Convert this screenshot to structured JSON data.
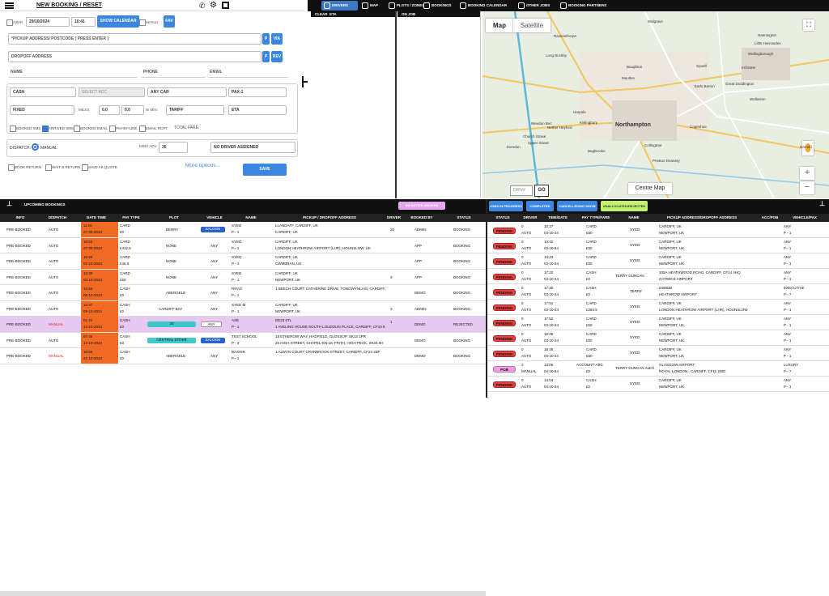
{
  "header": {
    "title": "NEW BOOKING / RESET"
  },
  "tabs": [
    {
      "label": "DRIVERS",
      "active": true
    },
    {
      "label": "MAP"
    },
    {
      "label": "PLOTS / ZONES"
    },
    {
      "label": "BOOKINGS"
    },
    {
      "label": "BOOKING CALENDAR"
    },
    {
      "label": "OTHER JOBS"
    },
    {
      "label": "BOOKING PARTNERS"
    }
  ],
  "form": {
    "asap": "ASAP",
    "date": "29/10/2024",
    "time": "10:41",
    "show_calendar": "SHOW CALENDAR",
    "repeat": "REPEAT",
    "fav": "FAV",
    "pickup_placeholder": "*PICKUP ADDRESS/ POSTCODE [ PRESS ENTER ]",
    "p_btn": "P",
    "via_btn": "VIA",
    "dropoff_placeholder": "DROPOFF ADDRESS",
    "rev_btn": "REV",
    "name_ph": "NAME",
    "phone_ph": "PHONE",
    "email_ph": "EMAIL",
    "pay": "CASH",
    "acc": "SELECT ACC",
    "car": "ANY CAR",
    "pax": "PAX-1",
    "fixed": "FIXED",
    "miles_label": "MILES",
    "miles_val": "0.0",
    "miles_val2": "0.0",
    "wmin_label": "W MIN",
    "tariff": "TARIFF",
    "eta": "ETA",
    "booked_sms": "BOOKED SMS",
    "arrived_sms": "ARRIVED SMS",
    "booked_email": "BOOKED EMAIL",
    "pay_by_link": "PAY-BY-LINK",
    "email_rcpt": "EMAIL RCPT",
    "total_fare": "TOTAL FARE:",
    "dispatch_label": "DISPATCH:",
    "manual": "MANUAL",
    "mins_adv_label": "MINS ADV",
    "mins_adv": "35",
    "driver_select": "NO DRIVER ASSIGNED",
    "book_return": "BOOK RETURN",
    "wait_return": "WAIT & RETURN",
    "save_quote": "SAVE AS QUOTE",
    "more_options": "More options...",
    "save": "SAVE"
  },
  "drivers_panel": {
    "clear": "CLEAR",
    "eta": "ETA",
    "on_job": "ON JOB"
  },
  "map": {
    "map_tab": "Map",
    "satellite_tab": "Satellite",
    "centre": "Centre Map",
    "driver_ph": "DRIV#",
    "go": "GO",
    "places": [
      "Walgrave",
      "Ravensthorpe",
      "Hannington",
      "Little Harrowden",
      "Wellingborough",
      "Long Buckby",
      "Moulton",
      "Sywell",
      "Irchester",
      "Earls Barton",
      "Great Doddington",
      "Boughton",
      "Wollaston",
      "Harpole",
      "Northampton",
      "Kislingbury",
      "Collingtree",
      "Cogenhoe",
      "Bugbrooke",
      "Preston Deanery",
      "Nether Heyford",
      "Weedon Bec",
      "Church Stowe",
      "Upper Stowe",
      "Everdon",
      "Harrold"
    ]
  },
  "upcoming": {
    "title": "UPCOMING BOOKINGS",
    "badge": "NO ACTIVE DRIVERS",
    "columns": [
      "INFO",
      "DISPATCH",
      "DATE TIME",
      "PAY TYPE",
      "PLOT",
      "VEHICLE",
      "NAME",
      "PICKUP / DROPOFF ADDRESS",
      "DRIVER",
      "BOOKED BY",
      "STATUS"
    ],
    "rows": [
      {
        "info": "PRE-BOOKED",
        "dispatch": "AUTO",
        "time": "11:00",
        "date": "27-09-2024",
        "pay": "CARD",
        "fare": "£0",
        "plot": "BERRY",
        "vehicle": "SALOON",
        "name": "SYED",
        "pax": "P - 1",
        "pickup": "LLANDAFF, CARDIFF, UK",
        "dropoff": "CARDIFF, UK",
        "driver": "20",
        "booked": "ADMIN",
        "status": "BOOKING"
      },
      {
        "info": "PRE-BOOKED",
        "dispatch": "AUTO",
        "time": "15:53",
        "date": "27-09-2024",
        "pay": "CARD",
        "fare": "£412.5",
        "plot": "NONE",
        "vehicle": "ANY",
        "name": "SYED",
        "pax": "P - 1",
        "pickup": "CARDIFF, UK",
        "dropoff": "LONDON HEATHROW AIRPORT (LHR), HOUNSLOW, UK",
        "driver": "",
        "booked": "APP",
        "status": "BOOKING"
      },
      {
        "info": "PRE-BOOKED",
        "dispatch": "AUTO",
        "time": "15:48",
        "date": "02-10-2024",
        "pay": "CARD",
        "fare": "£45.5",
        "plot": "NONE",
        "vehicle": "ANY",
        "name": "SYED",
        "pax": "P - 1",
        "pickup": "CARDIFF, UK",
        "dropoff": "CWMBRAN, UK",
        "driver": "",
        "booked": "APP",
        "status": "BOOKING"
      },
      {
        "info": "PRE-BOOKED",
        "dispatch": "AUTO",
        "time": "10:39",
        "date": "03-10-2024",
        "pay": "CARD",
        "fare": "£50",
        "plot": "NONE",
        "vehicle": "ANY",
        "name": "SYED",
        "pax": "P - 1",
        "pickup": "CARDIFF, UK",
        "dropoff": "NEWPORT, UK",
        "driver": "3",
        "booked": "APP",
        "status": "BOOKING"
      },
      {
        "info": "PRE-BOOKED",
        "dispatch": "AUTO",
        "time": "15:59",
        "date": "08-10-2024",
        "pay": "CASH",
        "fare": "£0",
        "plot": "ABERGELE",
        "vehicle": "ANY",
        "name": "RIFAS",
        "pax": "P - 1",
        "pickup": "1 BEECH COURT CATHERINE DRIVE, TONGWYNLAIS, CARDIFF,",
        "dropoff": "",
        "driver": "",
        "booked": "DEMO",
        "status": "BOOKING"
      },
      {
        "info": "PRE-BOOKED",
        "dispatch": "AUTO",
        "time": "12:37",
        "date": "09-10-2024",
        "pay": "CASH",
        "fare": "£0",
        "plot": "CARDIFF BAY",
        "vehicle": "ANY",
        "name": "SYED M",
        "pax": "P - 1",
        "pickup": "CARDIFF, UK",
        "dropoff": "NEWPORT, UK",
        "driver": "2",
        "booked": "ADMIN",
        "status": "BOOKING"
      },
      {
        "info": "PRE-BOOKED",
        "dispatch": "MANUAL",
        "time": "01:42",
        "date": "13-10-2024",
        "pay": "CASH",
        "fare": "£0",
        "plot": "20",
        "vehicle": "ANY",
        "name": "ASE",
        "pax": "P - 1",
        "pickup": "DE23 6TL",
        "dropoff": "1 AVELING HOUSE SOUTH LOUDOUN PLACE, CARDIFF, CF10 5",
        "driver": "1",
        "booked": "DEMO",
        "status": "REJECTED"
      },
      {
        "info": "PRE-BOOKED",
        "dispatch": "AUTO",
        "time": "07:45",
        "date": "14-10-2024",
        "pay": "CASH",
        "fare": "£0",
        "plot": "CENTRAL STOKE",
        "vehicle": "SALOON",
        "name": "TEST SCHOOL",
        "pax": "P - 4",
        "pickup": "18 ETHEROW WAY, HADFIELD, GLOSSOP, SK13 1PR",
        "dropoff": "25 HIGH STREET, CHAPEL-EN-LE-FRITH, HIGH PEAK, SK23 0H",
        "driver": "",
        "booked": "DEMO",
        "status": "BOOKING"
      },
      {
        "info": "PRE-BOOKED",
        "dispatch": "MANUAL",
        "time": "15:58",
        "date": "21-10-2024",
        "pay": "CASH",
        "fare": "£0",
        "plot": "ABERGELE",
        "vehicle": "ANY",
        "name": "BASHIR",
        "pax": "P - 1",
        "pickup": "1 ALWYN COURT CRANBROOK STREET, CARDIFF, CF24 4BF",
        "dropoff": "",
        "driver": "",
        "booked": "DEMO",
        "status": "BOOKING"
      }
    ]
  },
  "jobs": {
    "tabs": [
      "JOBS IN PROGRESS",
      "COMPLETED",
      "CANCELLED/NO SHOW",
      "UNALLOCATED/REJECTED"
    ],
    "columns": [
      "STATUS",
      "DRIVER",
      "TIME/DATE",
      "PAY TYPE/FARE",
      "NAME",
      "PICKUP ADDRESS/DROPOFF ADDRESS",
      "ACC/POB",
      "VEHICLE/PAX"
    ],
    "rows": [
      {
        "status": "PENDING",
        "d1": "0",
        "d2": "AUTO",
        "t1": "10:37",
        "t2": "03-10-24",
        "p1": "CARD",
        "p2": "£50",
        "name": "SYED",
        "a1": "CARDIFF, UK",
        "a2": "NEWPORT, UK",
        "v1": "ANY",
        "v2": "P - 1"
      },
      {
        "status": "PENDING",
        "d1": "0",
        "d2": "AUTO",
        "t1": "10:42",
        "t2": "03-10-24",
        "p1": "CARD",
        "p2": "£50",
        "name": "SYED",
        "a1": "CARDIFF, UK",
        "a2": "NEWPORT, UK",
        "v1": "ANY",
        "v2": "P - 1"
      },
      {
        "status": "PENDING",
        "d1": "0",
        "d2": "AUTO",
        "t1": "10:43",
        "t2": "03-10-24",
        "p1": "CARD",
        "p2": "£50",
        "name": "SYED",
        "a1": "CARDIFF, UK",
        "a2": "NEWPORT, UK",
        "v1": "ANY",
        "v2": "P - 1"
      },
      {
        "status": "PENDING",
        "d1": "0",
        "d2": "AUTO",
        "t1": "17:20",
        "t2": "03-10-24",
        "p1": "CASH",
        "p2": "£0",
        "name": "TERRY DUNCAN",
        "a1": "205A HEATHWOOD ROAD, CARDIFF, CF14 4HQ",
        "a2": "GATWICK AIRPORT",
        "v1": "ANY",
        "v2": "P - 1"
      },
      {
        "status": "PENDING",
        "d1": "0",
        "d2": "AUTO",
        "t1": "17:30",
        "t2": "03-10-24",
        "p1": "CASH",
        "p2": "£0",
        "name": "TERRY",
        "a1": "G698JB",
        "a2": "HEATHROW AIRPORT",
        "v1": "EXECUTIVE",
        "v2": "P - 7"
      },
      {
        "status": "PENDING",
        "d1": "0",
        "d2": "AUTO",
        "t1": "17:51",
        "t2": "03-10-24",
        "p1": "CARD",
        "p2": "£284.5",
        "name": "SYED",
        "a1": "CARDIFF, UK",
        "a2": "LONDON HEATHROW AIRPORT (LHR), HOUNSLOW",
        "v1": "ANY",
        "v2": "P - 1"
      },
      {
        "status": "PENDING",
        "d1": "0",
        "d2": "AUTO",
        "t1": "17:52",
        "t2": "03-10-24",
        "p1": "CARD",
        "p2": "£50",
        "name": "SYED",
        "a1": "CARDIFF, UK",
        "a2": "NEWPORT, UK",
        "v1": "ANY",
        "v2": "P - 1"
      },
      {
        "status": "PENDING",
        "d1": "0",
        "d2": "AUTO",
        "t1": "18:46",
        "t2": "03-10-24",
        "p1": "CARD",
        "p2": "£50",
        "name": "SYED",
        "a1": "CARDIFF, UK",
        "a2": "NEWPORT, UK",
        "v1": "ANY",
        "v2": "P - 1"
      },
      {
        "status": "PENDING",
        "d1": "0",
        "d2": "AUTO",
        "t1": "18:48",
        "t2": "03-10-24",
        "p1": "CARD",
        "p2": "£50",
        "name": "SYED",
        "a1": "CARDIFF, UK",
        "a2": "NEWPORT, UK",
        "v1": "ANY",
        "v2": "P - 1"
      },
      {
        "status": "POB",
        "d1": "2",
        "d2": "MANUAL",
        "t1": "13:05",
        "t2": "04-10-24",
        "p1": "ACCOUNT-ABC",
        "p2": "£0",
        "name": "TERRY DUNCAN ALEX",
        "a1": "GLASGOW AIRPORT",
        "a2": "ROYAL LONDON , CARDIFF, CF11 2WD",
        "v1": "LUXURY",
        "v2": "P - 7"
      },
      {
        "status": "PENDING",
        "d1": "0",
        "d2": "AUTO",
        "t1": "14:04",
        "t2": "04-10-24",
        "p1": "CASH",
        "p2": "£0",
        "name": "SYED",
        "a1": "CARDIFF, UK",
        "a2": "NEWPORT, UK",
        "v1": "ANY",
        "v2": "P - 1"
      }
    ]
  },
  "colors": {
    "accent": "#3a86e0",
    "dark": "#111111",
    "orange": "#f06a23",
    "pending": "#e84040",
    "pob": "#f0a0e0",
    "rejected": "#e6c8f0",
    "saloon": "#2a62c9",
    "stoke": "#3fb8d8"
  }
}
